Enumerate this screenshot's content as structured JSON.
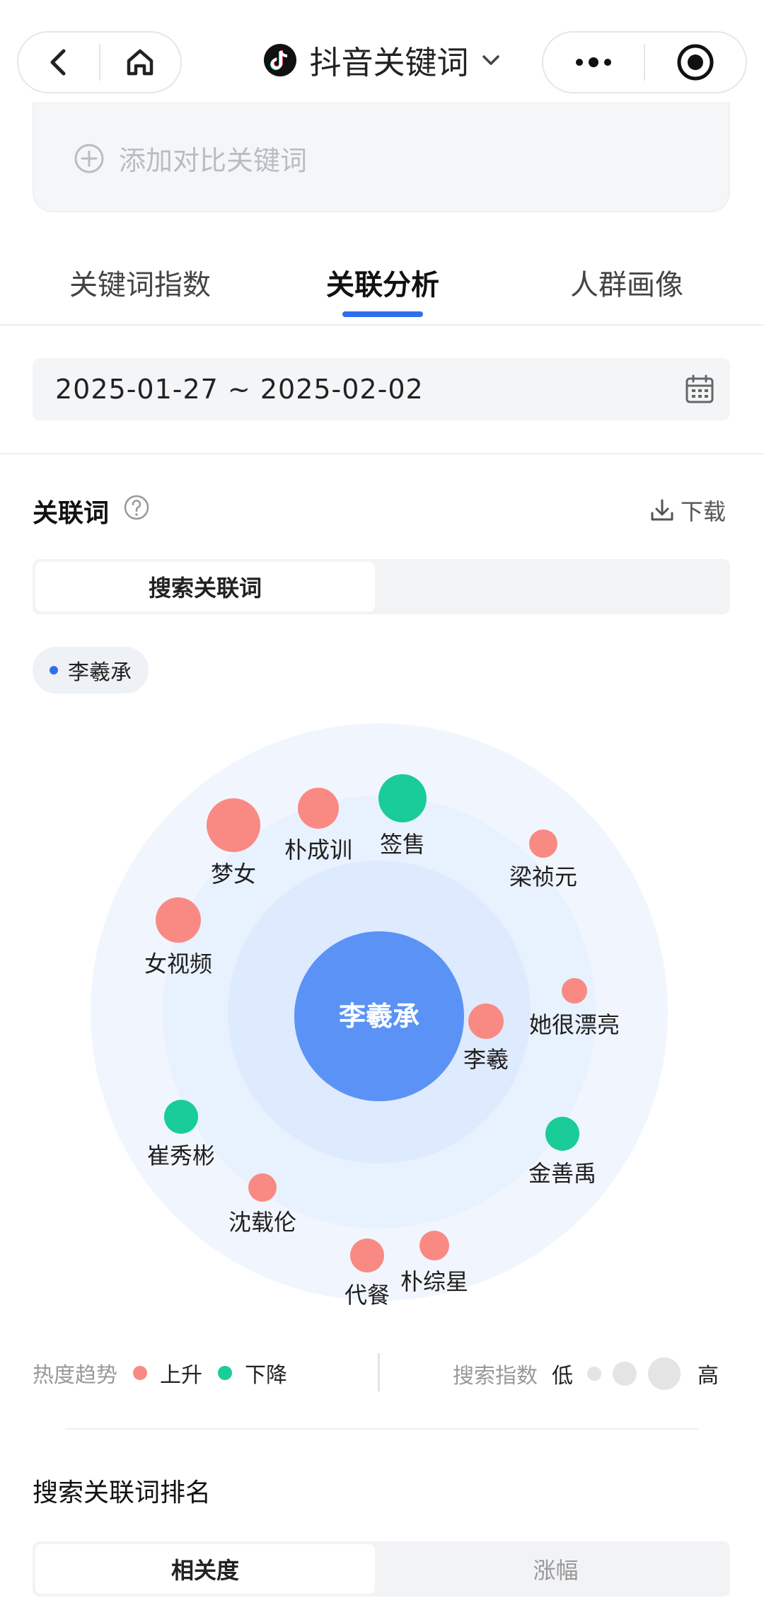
{
  "nav": {
    "title": "抖音关键词"
  },
  "compare": {
    "placeholder": "添加对比关键词"
  },
  "tabs": [
    {
      "label": "关键词指数"
    },
    {
      "label": "关联分析"
    },
    {
      "label": "人群画像"
    }
  ],
  "date_range": "2025-01-27  ~  2025-02-02",
  "related": {
    "title": "关联词",
    "download": "下载",
    "segment_left": "搜索关联词",
    "chip": "李羲承",
    "center": "李羲承",
    "colors": {
      "rise": "#f98a83",
      "fall": "#19cc98",
      "center": "#5b92f5"
    }
  },
  "bubbles": [
    {
      "label": "梦女",
      "trend": "rise"
    },
    {
      "label": "朴成训",
      "trend": "rise"
    },
    {
      "label": "签售",
      "trend": "fall"
    },
    {
      "label": "梁祯元",
      "trend": "rise"
    },
    {
      "label": "女视频",
      "trend": "rise"
    },
    {
      "label": "她很漂亮",
      "trend": "rise"
    },
    {
      "label": "李羲",
      "trend": "rise"
    },
    {
      "label": "崔秀彬",
      "trend": "fall"
    },
    {
      "label": "金善禹",
      "trend": "fall"
    },
    {
      "label": "沈载伦",
      "trend": "rise"
    },
    {
      "label": "代餐",
      "trend": "rise"
    },
    {
      "label": "朴综星",
      "trend": "rise"
    }
  ],
  "legend": {
    "trend_label": "热度趋势",
    "rise": "上升",
    "fall": "下降",
    "index_label": "搜索指数",
    "low": "低",
    "high": "高"
  },
  "ranking": {
    "title": "搜索关联词排名",
    "opt_a": "相关度",
    "opt_b": "涨幅"
  }
}
